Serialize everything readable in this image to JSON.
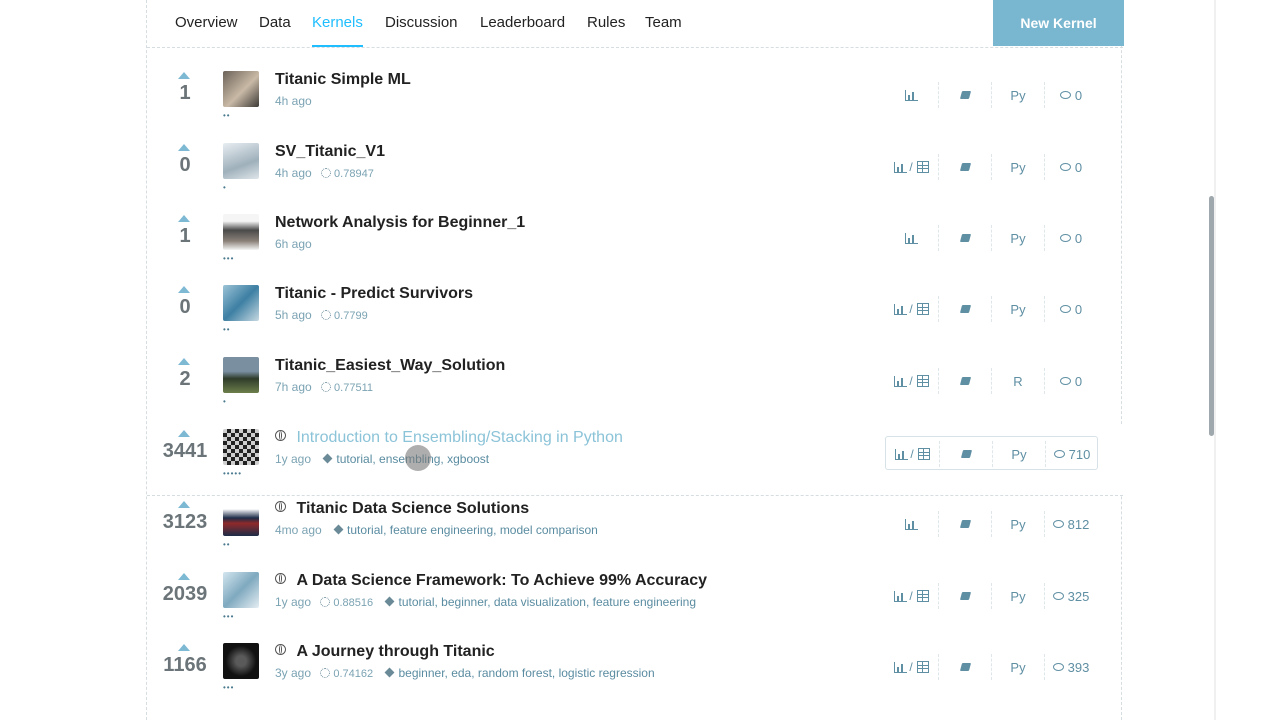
{
  "tabs": [
    {
      "label": "Overview"
    },
    {
      "label": "Data"
    },
    {
      "label": "Kernels",
      "active": true
    },
    {
      "label": "Discussion"
    },
    {
      "label": "Leaderboard"
    },
    {
      "label": "Rules"
    },
    {
      "label": "Team"
    }
  ],
  "new_kernel_label": "New Kernel",
  "kernels": [
    {
      "votes": "1",
      "title": "Titanic Simple ML",
      "time": "4h ago",
      "score": "",
      "tags": "",
      "output": "chart",
      "lang": "Py",
      "comments": "0",
      "medal": false,
      "dots": "••"
    },
    {
      "votes": "0",
      "title": "SV_Titanic_V1",
      "time": "4h ago",
      "score": "0.78947",
      "tags": "",
      "output": "chart-table",
      "lang": "Py",
      "comments": "0",
      "medal": false,
      "dots": "•"
    },
    {
      "votes": "1",
      "title": "Network Analysis for Beginner_1",
      "time": "6h ago",
      "score": "",
      "tags": "",
      "output": "chart",
      "lang": "Py",
      "comments": "0",
      "medal": false,
      "dots": "•••"
    },
    {
      "votes": "0",
      "title": "Titanic - Predict Survivors",
      "time": "5h ago",
      "score": "0.7799",
      "tags": "",
      "output": "chart-table",
      "lang": "Py",
      "comments": "0",
      "medal": false,
      "dots": "••"
    },
    {
      "votes": "2",
      "title": "Titanic_Easiest_Way_Solution",
      "time": "7h ago",
      "score": "0.77511",
      "tags": "",
      "output": "chart-table",
      "lang": "R",
      "comments": "0",
      "medal": false,
      "dots": "•"
    },
    {
      "votes": "3441",
      "title": "Introduction to Ensembling/Stacking in Python",
      "time": "1y ago",
      "score": "",
      "tags": "tutorial, ensembling, xgboost",
      "output": "chart-table",
      "lang": "Py",
      "comments": "710",
      "medal": true,
      "dots": "•••••",
      "highlight": true
    },
    {
      "votes": "3123",
      "title": "Titanic Data Science Solutions",
      "time": "4mo ago",
      "score": "",
      "tags": "tutorial, feature engineering, model comparison",
      "output": "chart",
      "lang": "Py",
      "comments": "812",
      "medal": true,
      "dots": "••"
    },
    {
      "votes": "2039",
      "title": "A Data Science Framework: To Achieve 99% Accuracy",
      "time": "1y ago",
      "score": "0.88516",
      "tags": "tutorial, beginner, data visualization, feature engineering",
      "output": "chart-table",
      "lang": "Py",
      "comments": "325",
      "medal": true,
      "dots": "•••"
    },
    {
      "votes": "1166",
      "title": "A Journey through Titanic",
      "time": "3y ago",
      "score": "0.74162",
      "tags": "beginner, eda, random forest, logistic regression",
      "output": "chart-table",
      "lang": "Py",
      "comments": "393",
      "medal": true,
      "dots": "•••"
    }
  ],
  "colors": {
    "accent": "#20beff",
    "button": "#79b6cf",
    "meta": "#7ba3b3"
  }
}
